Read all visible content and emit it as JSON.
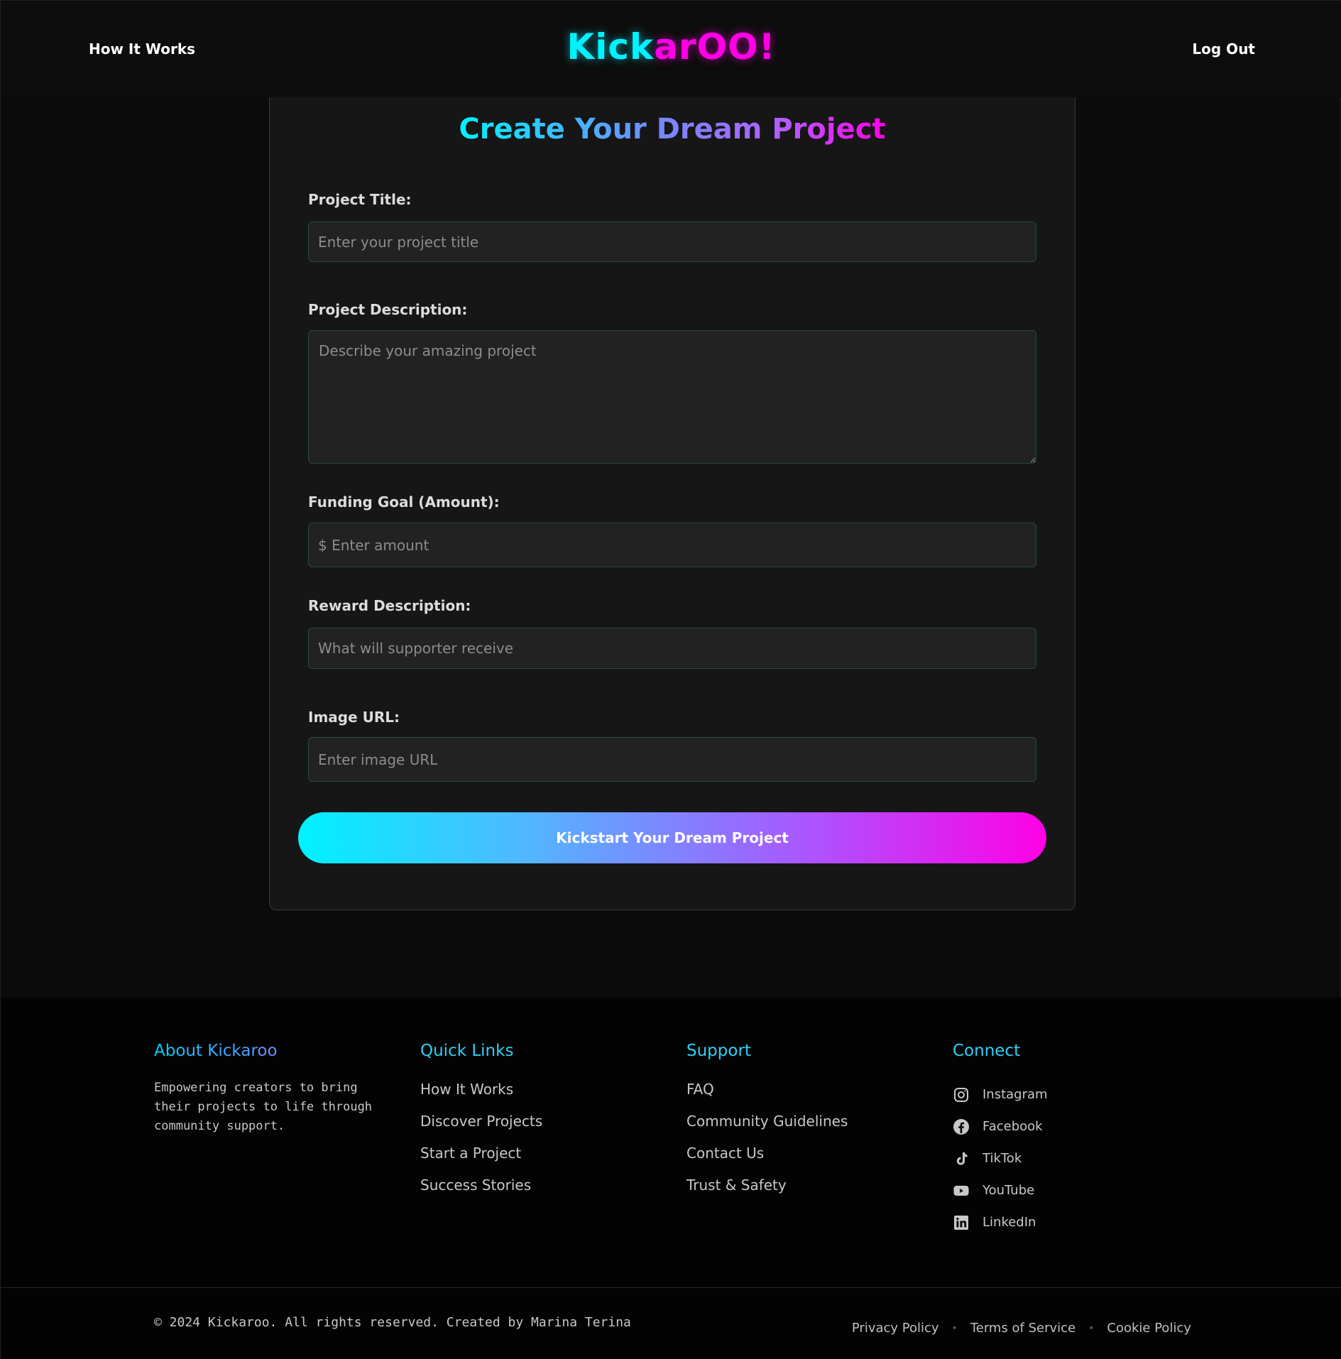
{
  "header": {
    "nav_left": "How It Works",
    "nav_right": "Log Out",
    "logo_part1": "Kick",
    "logo_part2": "arOO!"
  },
  "form": {
    "title": "Create Your Dream Project",
    "fields": {
      "title_label": "Project Title:",
      "title_placeholder": "Enter your project title",
      "description_label": "Project Description:",
      "description_placeholder": "Describe your amazing project",
      "goal_label": "Funding Goal (Amount):",
      "goal_placeholder": "$ Enter amount",
      "reward_label": "Reward Description:",
      "reward_placeholder": "What will supporter receive",
      "image_label": "Image URL:",
      "image_placeholder": "Enter image URL"
    },
    "submit_label": "Kickstart Your Dream Project"
  },
  "footer": {
    "about": {
      "heading": "About Kickaroo",
      "text": "Empowering creators to bring their projects to life through community support."
    },
    "quick_links": {
      "heading": "Quick Links",
      "items": [
        "How It Works",
        "Discover Projects",
        "Start a Project",
        "Success Stories"
      ]
    },
    "support": {
      "heading": "Support",
      "items": [
        "FAQ",
        "Community Guidelines",
        "Contact Us",
        "Trust & Safety"
      ]
    },
    "connect": {
      "heading": "Connect",
      "items": [
        {
          "label": "Instagram",
          "icon": "instagram-icon"
        },
        {
          "label": "Facebook",
          "icon": "facebook-icon"
        },
        {
          "label": "TikTok",
          "icon": "tiktok-icon"
        },
        {
          "label": "YouTube",
          "icon": "youtube-icon"
        },
        {
          "label": "LinkedIn",
          "icon": "linkedin-icon"
        }
      ]
    },
    "copyright": "© 2024 Kickaroo. All rights reserved. Created by Marina Terina",
    "legal": [
      "Privacy Policy",
      "Terms of Service",
      "Cookie Policy"
    ]
  },
  "colors": {
    "cyan": "#00f2ff",
    "magenta": "#ff00e6",
    "background": "#0b0b0b",
    "card": "#161616",
    "field_border": "#244a3c"
  }
}
